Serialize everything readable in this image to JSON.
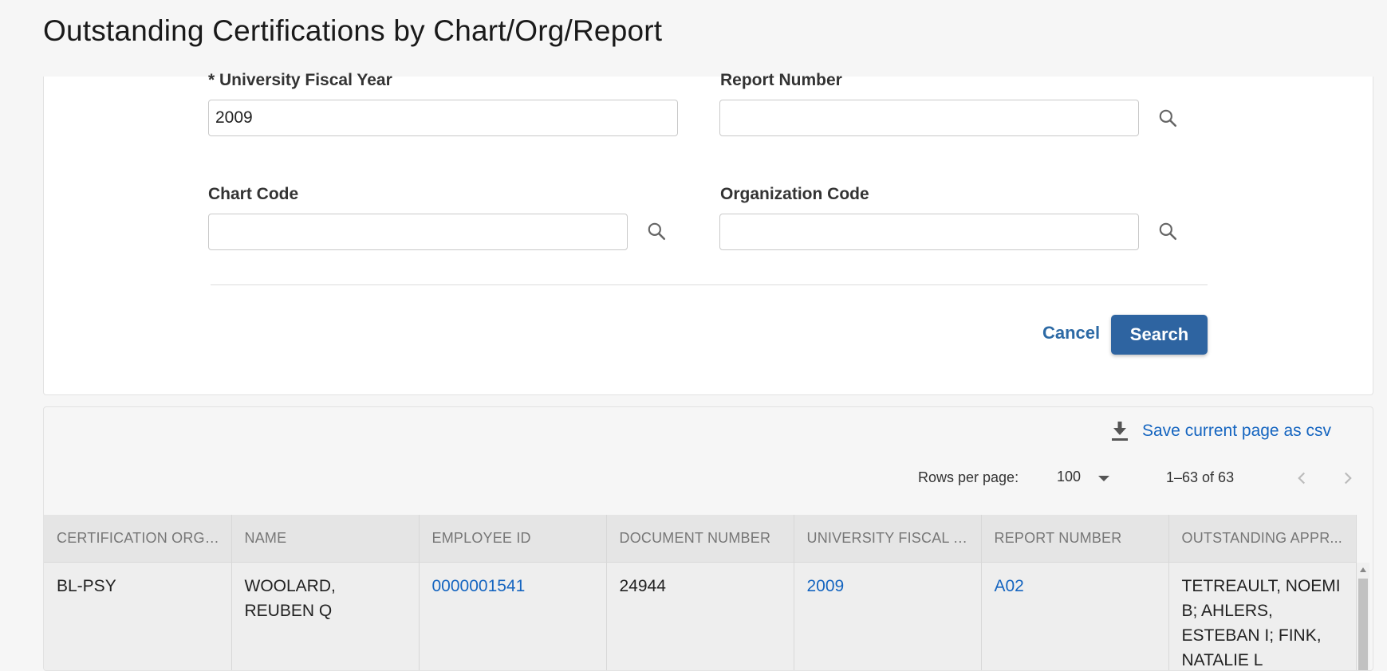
{
  "page": {
    "title": "Outstanding Certifications by Chart/Org/Report"
  },
  "form": {
    "fiscal_year": {
      "label": "* University Fiscal Year",
      "value": "2009"
    },
    "report_number": {
      "label": "Report Number",
      "value": ""
    },
    "chart_code": {
      "label": "Chart Code",
      "value": ""
    },
    "organization_code": {
      "label": "Organization Code",
      "value": ""
    },
    "cancel_label": "Cancel",
    "search_label": "Search"
  },
  "results": {
    "csv_label": "Save current page as csv",
    "rows_per_page_label": "Rows per page:",
    "rows_per_page_value": "100",
    "range": "1–63 of 63",
    "columns": [
      "CERTIFICATION ORGA...",
      "NAME",
      "EMPLOYEE ID",
      "DOCUMENT NUMBER",
      "UNIVERSITY FISCAL Y...",
      "REPORT NUMBER",
      "OUTSTANDING APPR..."
    ],
    "rows": [
      {
        "org": "BL-PSY",
        "name": "WOOLARD, REUBEN Q",
        "employee_id": "0000001541",
        "document_number": "24944",
        "fiscal_year": "2009",
        "report_number": "A02",
        "approvers": "TETREAULT, NOEMI B; AHLERS, ESTEBAN I; FINK, NATALIE L"
      }
    ]
  },
  "colors": {
    "primary": "#2e64a1",
    "link": "#1565c0",
    "background": "#f6f6f6"
  },
  "icons": [
    "search-icon",
    "download-icon",
    "chevron-down-icon",
    "chevron-left-icon",
    "chevron-right-icon"
  ]
}
